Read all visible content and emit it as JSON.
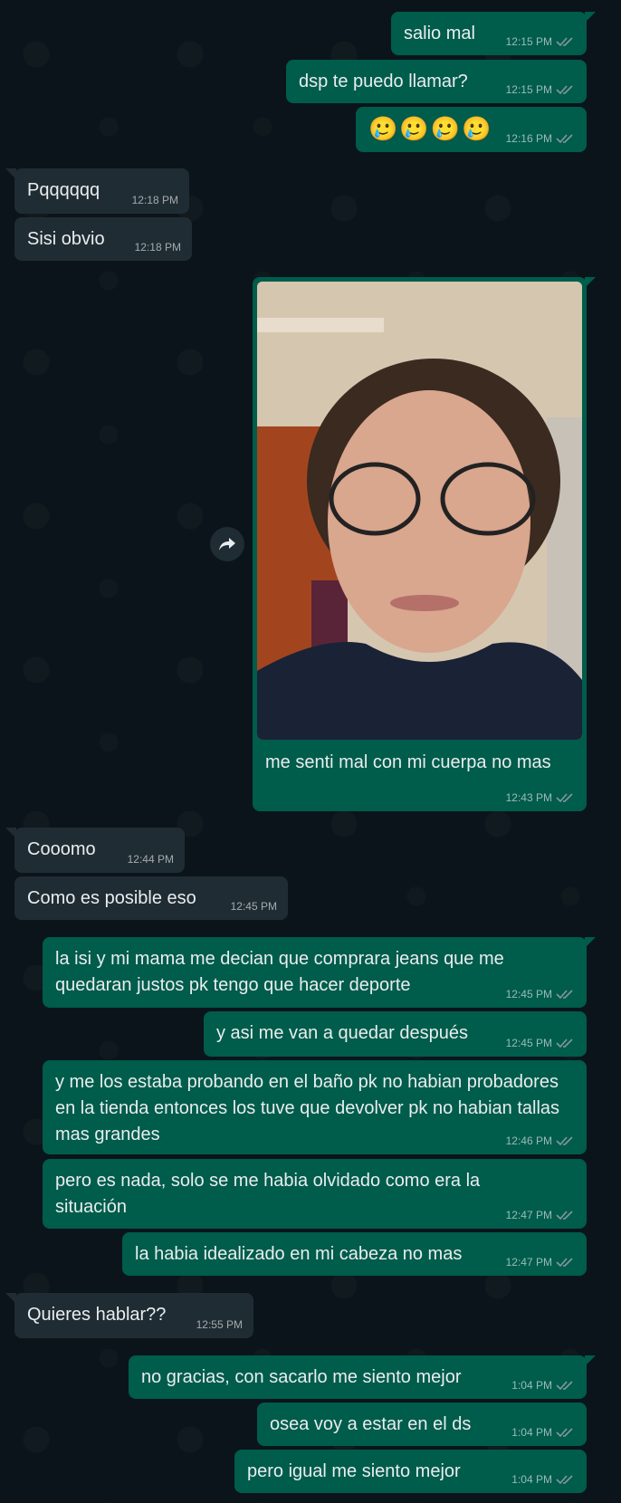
{
  "messages": [
    {
      "id": "m1",
      "side": "out",
      "text": "salio mal",
      "time": "12:15 PM"
    },
    {
      "id": "m2",
      "side": "out",
      "text": "dsp te puedo llamar?",
      "time": "12:15 PM"
    },
    {
      "id": "m3",
      "side": "out",
      "text": "🥲🥲🥲🥲",
      "time": "12:16 PM"
    },
    {
      "id": "m4",
      "side": "in",
      "text": "Pqqqqqq",
      "time": "12:18 PM"
    },
    {
      "id": "m5",
      "side": "in",
      "text": "Sisi obvio",
      "time": "12:18 PM"
    },
    {
      "id": "m6",
      "side": "out",
      "text": "me senti mal con mi cuerpa no mas",
      "time": "12:43 PM"
    },
    {
      "id": "m7",
      "side": "in",
      "text": "Cooomo",
      "time": "12:44 PM"
    },
    {
      "id": "m8",
      "side": "in",
      "text": "Como es posible eso",
      "time": "12:45 PM"
    },
    {
      "id": "m9",
      "side": "out",
      "text": "la isi y mi mama me decian que comprara jeans que me quedaran justos pk tengo que hacer deporte",
      "time": "12:45 PM"
    },
    {
      "id": "m10",
      "side": "out",
      "text": "y asi me van a quedar después",
      "time": "12:45 PM"
    },
    {
      "id": "m11",
      "side": "out",
      "text": "y me los estaba probando en el baño pk no habian probadores en la tienda entonces los tuve que devolver pk no habian tallas mas grandes",
      "time": "12:46 PM"
    },
    {
      "id": "m12",
      "side": "out",
      "text": "pero es nada, solo se me habia olvidado como era la situación",
      "time": "12:47 PM"
    },
    {
      "id": "m13",
      "side": "out",
      "text": "la habia idealizado en mi cabeza no mas",
      "time": "12:47 PM"
    },
    {
      "id": "m14",
      "side": "in",
      "text": "Quieres hablar??",
      "time": "12:55 PM"
    },
    {
      "id": "m15",
      "side": "out",
      "text": "no gracias, con sacarlo me siento mejor",
      "time": "1:04 PM"
    },
    {
      "id": "m16",
      "side": "out",
      "text": "osea voy a estar en el ds",
      "time": "1:04 PM"
    },
    {
      "id": "m17",
      "side": "out",
      "text": "pero igual me siento mejor",
      "time": "1:04 PM"
    }
  ],
  "colors": {
    "background": "#0b141a",
    "outgoing_bubble": "#005c4b",
    "incoming_bubble": "#202c33",
    "read_ticks": "#8696a0"
  },
  "icons": {
    "forward": "forward-arrow-icon",
    "read_receipt": "double-check-icon"
  }
}
